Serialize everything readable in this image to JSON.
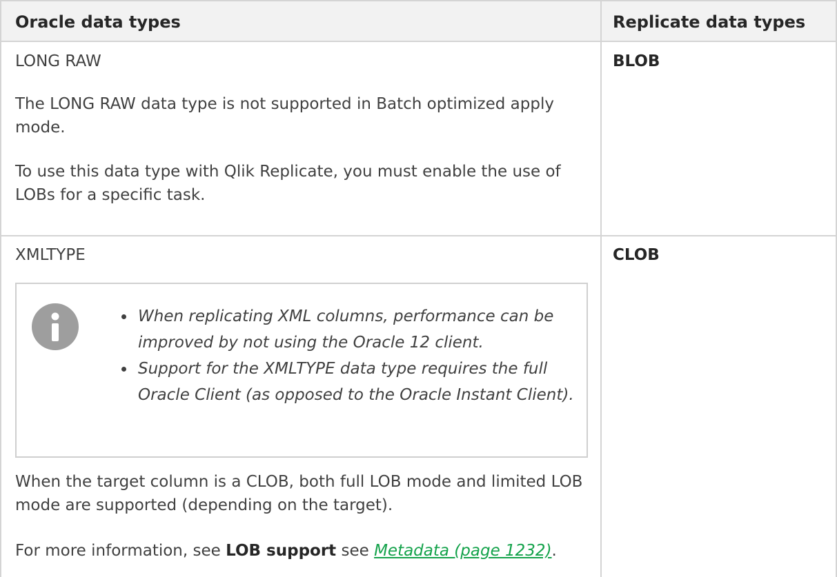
{
  "header": {
    "col1": "Oracle data types",
    "col2": "Replicate data types"
  },
  "rows": [
    {
      "oracle_type": "LONG RAW",
      "para1": "The LONG RAW data type is not supported in Batch optimized apply mode.",
      "para2": "To use this data type with Qlik Replicate, you must enable the use of LOBs for a specific task.",
      "replicate_type": "BLOB"
    },
    {
      "oracle_type": "XMLTYPE",
      "note_items": [
        "When replicating XML columns, performance can be improved by not using the Oracle 12 client.",
        "Support for the XMLTYPE data type requires the full Oracle Client (as opposed to the Oracle Instant Client)."
      ],
      "para1": "When the target column is a CLOB, both full LOB mode and limited LOB mode are supported (depending on the target).",
      "para2_prefix": "For more information, see ",
      "para2_bold": "LOB support",
      "para2_mid": " see ",
      "para2_link": "Metadata (page 1232)",
      "para2_suffix": ".",
      "replicate_type": "CLOB"
    }
  ],
  "colors": {
    "text": "#404040",
    "header_bg": "#f2f2f2",
    "border": "#d4d4d4",
    "link": "#13a24a",
    "info_icon": "#9e9e9e"
  },
  "icons": {
    "note": "info-icon"
  }
}
